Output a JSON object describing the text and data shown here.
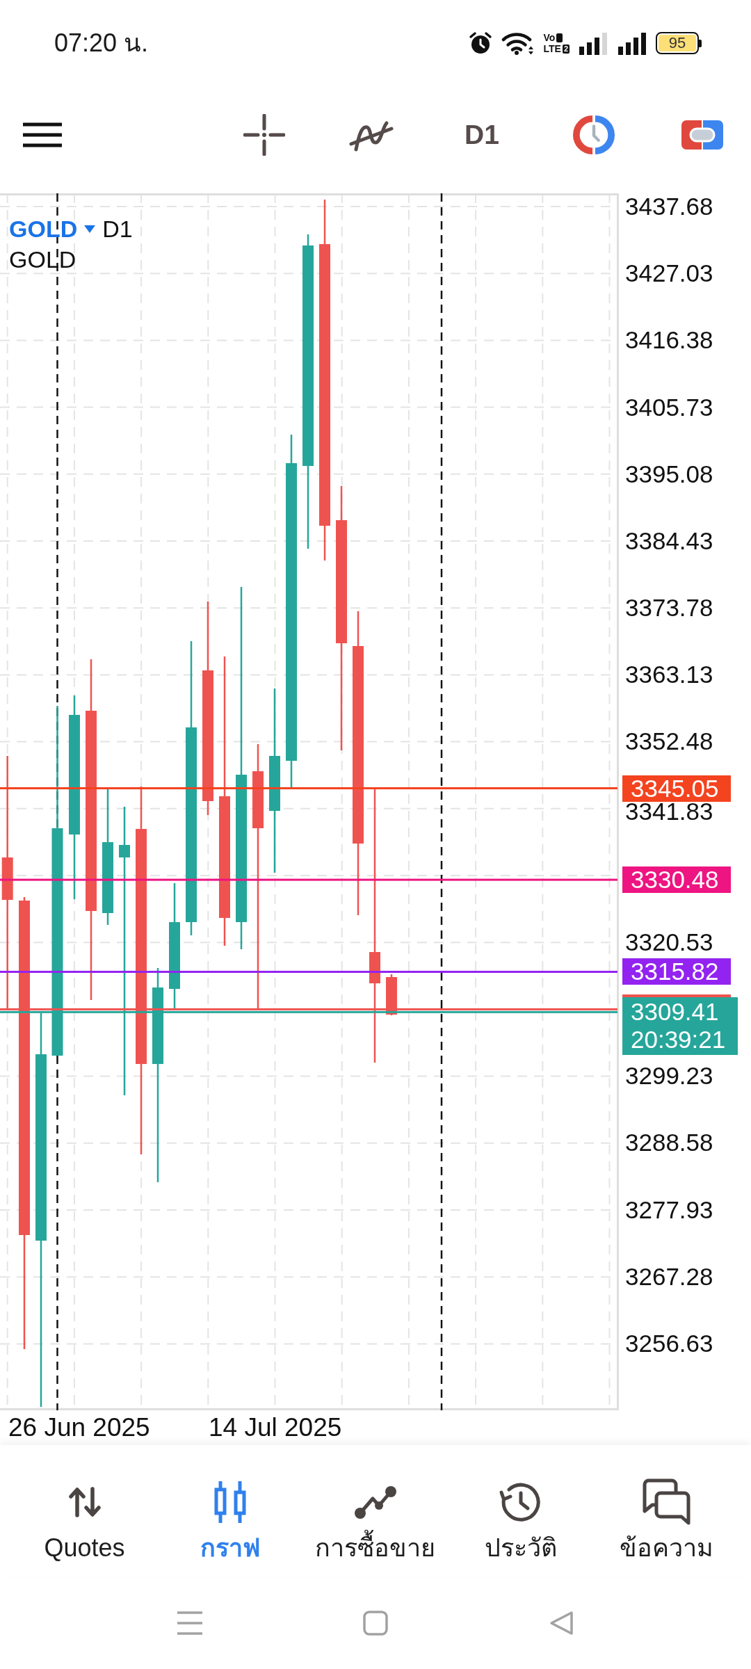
{
  "status_bar": {
    "time": "07:20 น.",
    "volte": {
      "top": "Vo",
      "bottom": "LTE",
      "sim": "2"
    },
    "battery": "95"
  },
  "toolbar": {
    "timeframe": "D1"
  },
  "chart": {
    "symbol": "GOLD",
    "timeframe": "D1",
    "description": "GOLD",
    "price_axis": [
      "3437.68",
      "3427.03",
      "3416.38",
      "3405.73",
      "3395.08",
      "3384.43",
      "3373.78",
      "3363.13",
      "3352.48",
      "3341.83",
      "3320.53",
      "3299.23",
      "3288.58",
      "3277.93",
      "3267.28",
      "3256.63"
    ],
    "price_lines": [
      {
        "kind": "level",
        "price": "3345.05",
        "color": "#f4431f"
      },
      {
        "kind": "level",
        "price": "3330.48",
        "color": "#ee1481"
      },
      {
        "kind": "level",
        "price": "3315.82",
        "color": "#9323f0"
      },
      {
        "kind": "ask",
        "color": "#ef5350"
      },
      {
        "kind": "bid",
        "price": "3309.41",
        "countdown": "20:39:21",
        "color": "#26a69a"
      }
    ],
    "date_axis": [
      "26 Jun 2025",
      "14 Jul 2025"
    ]
  },
  "bottom_nav": [
    {
      "label": "Quotes",
      "selected": false
    },
    {
      "label": "กราฟ",
      "selected": true
    },
    {
      "label": "การซื้อขาย",
      "selected": false
    },
    {
      "label": "ประวัติ",
      "selected": false
    },
    {
      "label": "ข้อความ",
      "selected": false
    }
  ]
}
